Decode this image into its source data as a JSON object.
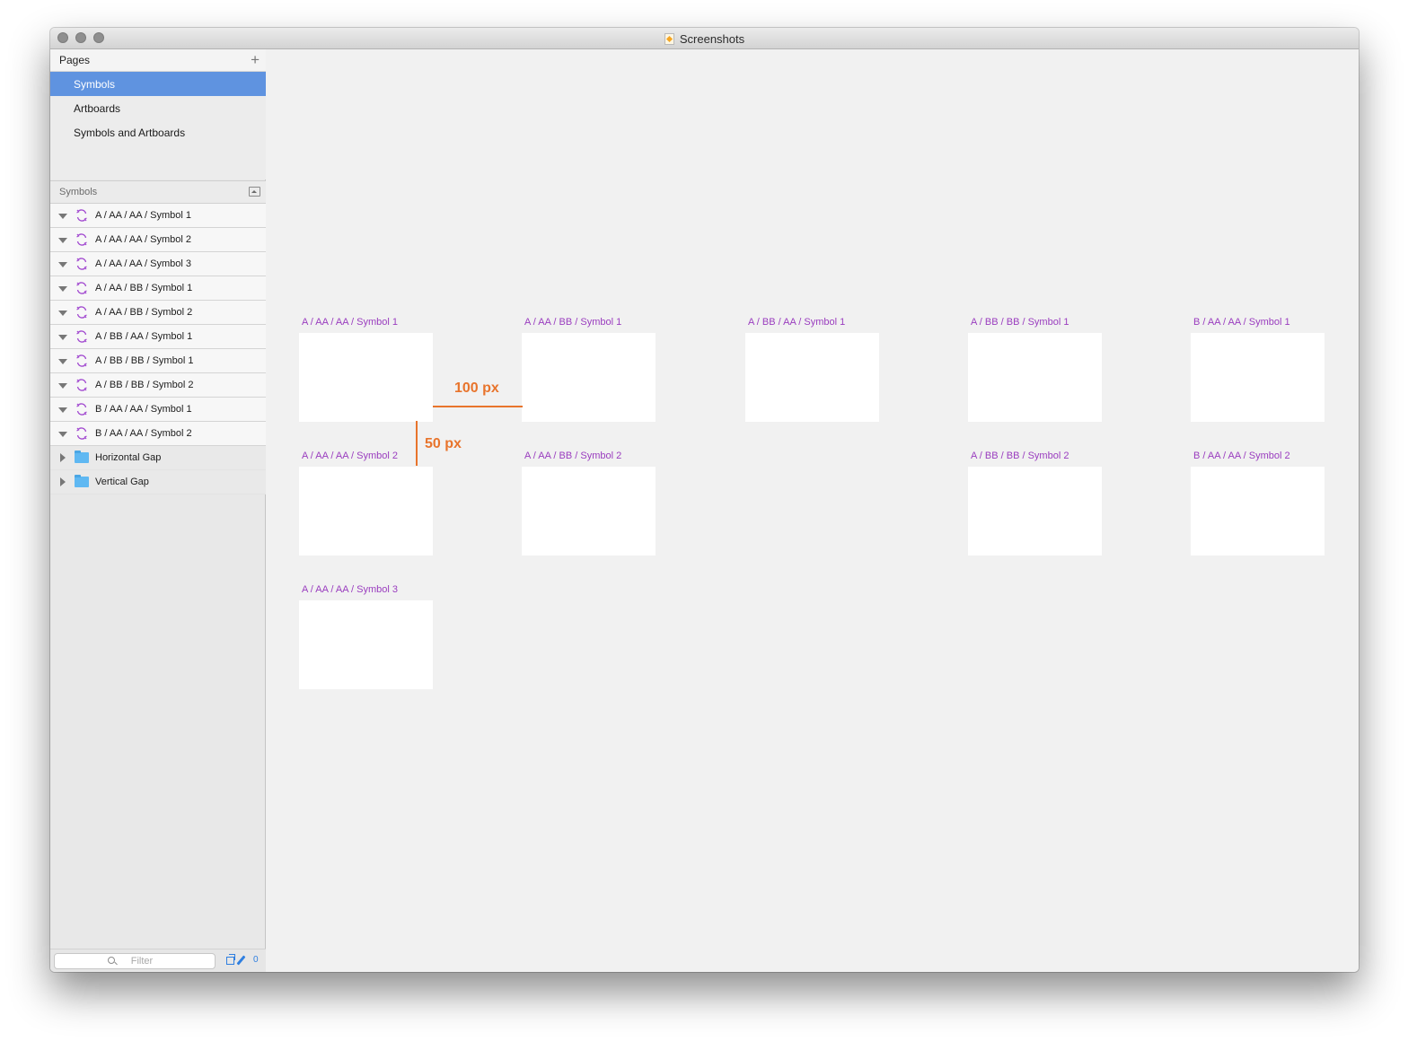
{
  "window": {
    "title": "Screenshots"
  },
  "pages_panel": {
    "header": "Pages",
    "add_icon": "plus-icon",
    "items": [
      {
        "label": "Symbols",
        "selected": true
      },
      {
        "label": "Artboards",
        "selected": false
      },
      {
        "label": "Symbols and Artboards",
        "selected": false
      }
    ]
  },
  "layers_panel": {
    "header": "Symbols",
    "collapse_icon": "collapse-icon",
    "symbols": [
      {
        "label": "A / AA / AA / Symbol 1"
      },
      {
        "label": "A / AA / AA / Symbol 2"
      },
      {
        "label": "A / AA / AA / Symbol 3"
      },
      {
        "label": "A / AA / BB / Symbol 1"
      },
      {
        "label": "A / AA / BB / Symbol 2"
      },
      {
        "label": "A / BB / AA / Symbol 1"
      },
      {
        "label": "A / BB / BB / Symbol 1"
      },
      {
        "label": "A / BB / BB / Symbol 2"
      },
      {
        "label": "B / AA / AA / Symbol 1"
      },
      {
        "label": "B / AA / AA / Symbol 2"
      }
    ],
    "groups": [
      {
        "label": "Horizontal Gap"
      },
      {
        "label": "Vertical Gap"
      }
    ]
  },
  "filter": {
    "placeholder": "Filter",
    "count": "0"
  },
  "canvas": {
    "artboards": [
      {
        "label": "A / AA / AA / Symbol 1"
      },
      {
        "label": "A / AA / BB / Symbol 1"
      },
      {
        "label": "A / BB / AA / Symbol 1"
      },
      {
        "label": "A / BB / BB / Symbol 1"
      },
      {
        "label": "B / AA / AA / Symbol 1"
      },
      {
        "label": "A / AA / AA / Symbol 2"
      },
      {
        "label": "A / AA / BB / Symbol 2"
      },
      {
        "label": "A / BB / BB / Symbol 2"
      },
      {
        "label": "B / AA / AA / Symbol 2"
      },
      {
        "label": "A / AA / AA / Symbol 3"
      }
    ],
    "horizontal_gap": "100 px",
    "vertical_gap": "50 px"
  },
  "colors": {
    "selection": "#5f93e0",
    "symbol_label": "#9a3dbf",
    "measure": "#e8742c",
    "accent": "#2f7fe0"
  }
}
